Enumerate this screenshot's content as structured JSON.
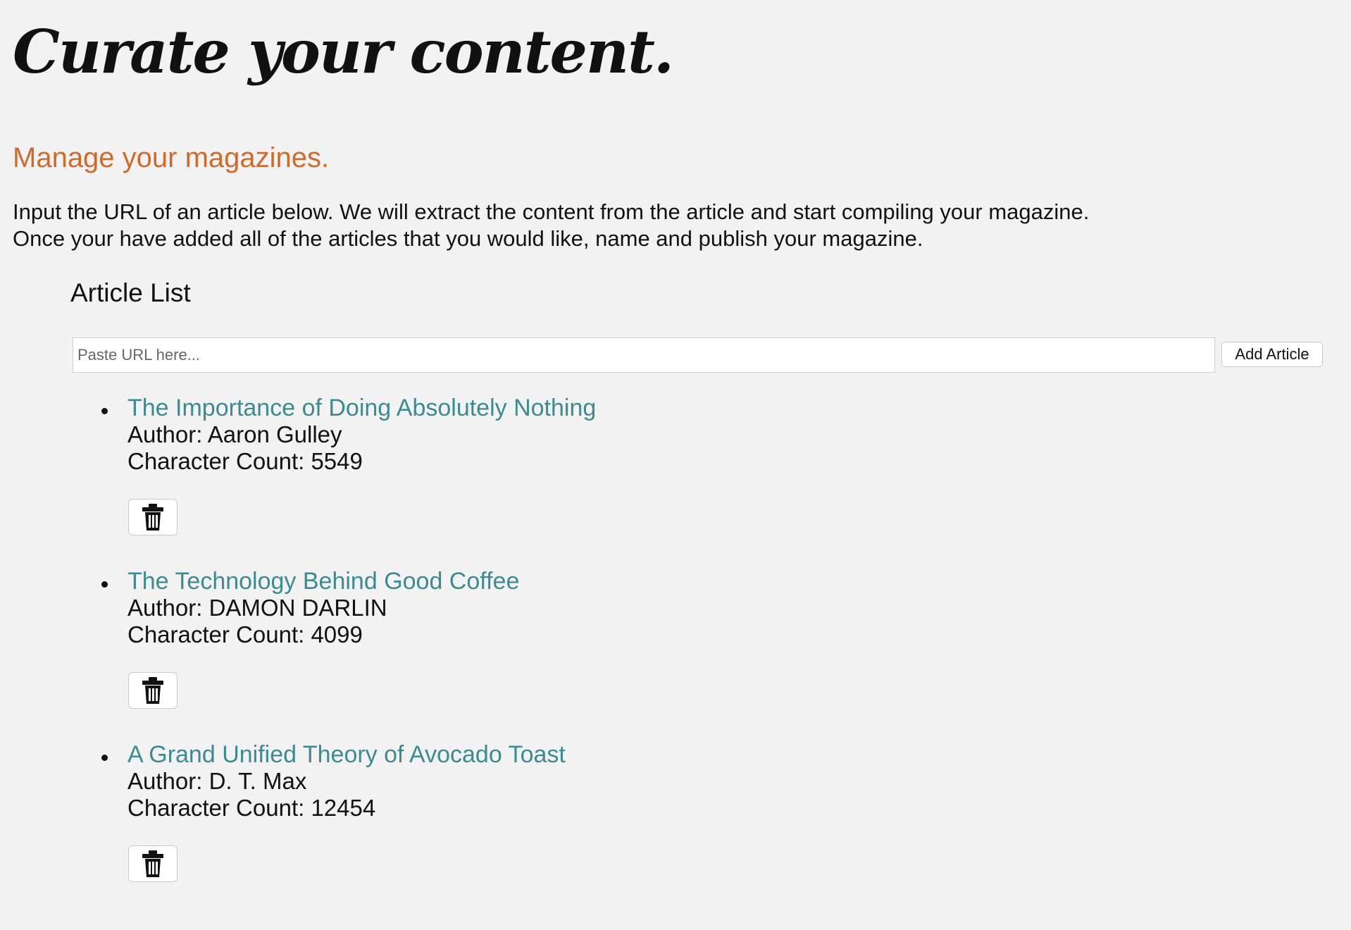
{
  "page": {
    "title": "Curate your content.",
    "subtitle": "Manage your magazines.",
    "intro_line_1": "Input the URL of an article below. We will extract the content from the article and start compiling your magazine.",
    "intro_line_2": "Once your have added all of the articles that you would like, name and publish your magazine."
  },
  "article_list": {
    "heading": "Article List",
    "url_placeholder": "Paste URL here...",
    "url_value": "",
    "add_button_label": "Add Article",
    "delete_icon": "trash-icon",
    "items": [
      {
        "title": "The Importance of Doing Absolutely Nothing",
        "author": "Author: Aaron Gulley",
        "character_count": "Character Count: 5549"
      },
      {
        "title": "The Technology Behind Good Coffee",
        "author": "Author: DAMON DARLIN",
        "character_count": "Character Count: 4099"
      },
      {
        "title": "A Grand Unified Theory of Avocado Toast",
        "author": "Author: D. T. Max",
        "character_count": "Character Count: 12454"
      }
    ]
  },
  "colors": {
    "background": "#f2f2f2",
    "subtitle": "#cd6b2f",
    "link": "#3d8a92",
    "text": "#111111"
  }
}
